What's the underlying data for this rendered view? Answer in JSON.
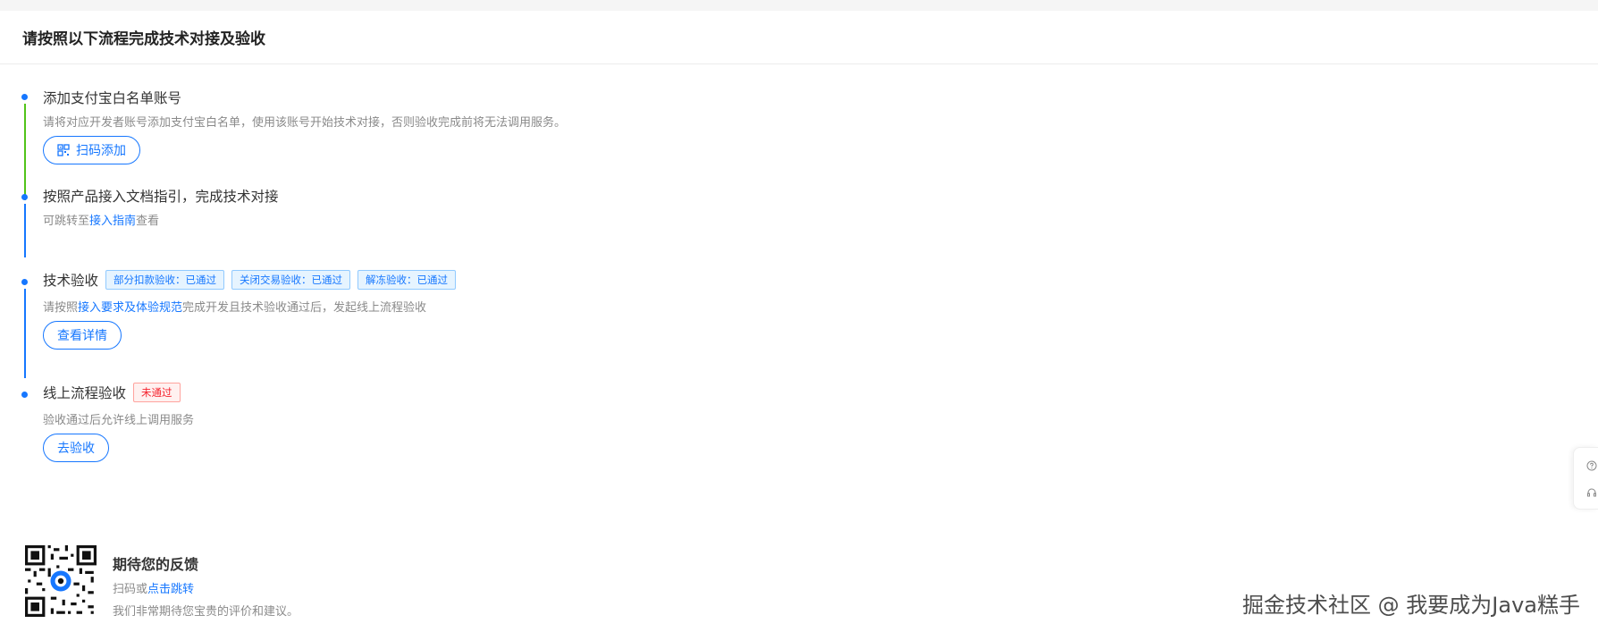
{
  "page": {
    "title": "请按照以下流程完成技术对接及验收"
  },
  "steps": [
    {
      "title": "添加支付宝白名单账号",
      "desc": "请将对应开发者账号添加支付宝白名单，使用该账号开始技术对接，否则验收完成前将无法调用服务。",
      "button": "扫码添加",
      "button_icon": "qr-code-icon"
    },
    {
      "title": "按照产品接入文档指引，完成技术对接",
      "desc_prefix": "可跳转至",
      "desc_link": "接入指南",
      "desc_suffix": "查看"
    },
    {
      "title": "技术验收",
      "tags": [
        "部分扣款验收：已通过",
        "关闭交易验收：已通过",
        "解冻验收：已通过"
      ],
      "desc_prefix": "请按照",
      "desc_link": "接入要求及体验规范",
      "desc_suffix": "完成开发且技术验收通过后，发起线上流程验收",
      "button": "查看详情"
    },
    {
      "title": "线上流程验收",
      "tag_fail": "未通过",
      "desc": "验收通过后允许线上调用服务",
      "button": "去验收"
    }
  ],
  "feedback": {
    "title": "期待您的反馈",
    "line1_prefix": "扫码或",
    "line1_link": "点击跳转",
    "line2": "我们非常期待您宝贵的评价和建议。"
  },
  "side_widget": {
    "icons": [
      "help-icon",
      "headset-icon"
    ]
  },
  "watermark": "掘金技术社区 @ 我要成为Java糕手",
  "colors": {
    "accent": "#1677ff",
    "tag_pass_bg": "#e6f4ff",
    "tag_fail": "#f5222d",
    "timeline_green": "#52c41a"
  }
}
